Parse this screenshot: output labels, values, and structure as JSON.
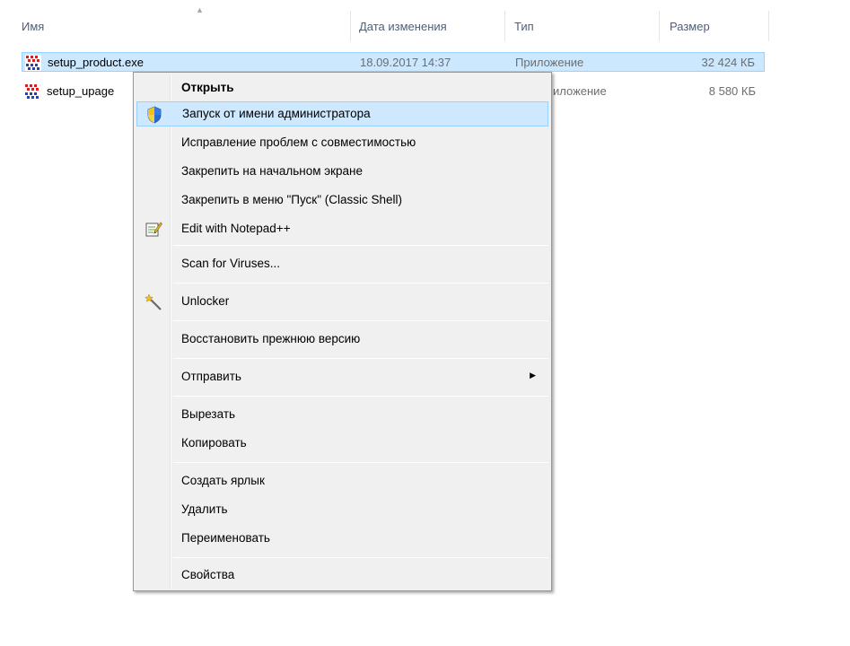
{
  "columns": {
    "name": "Имя",
    "date": "Дата изменения",
    "type": "Тип",
    "size": "Размер"
  },
  "files": [
    {
      "name": "setup_product.exe",
      "date": "18.09.2017 14:37",
      "type": "Приложение",
      "size": "32 424 КБ",
      "icon": "exe-installer-icon",
      "selected": true
    },
    {
      "name": "setup_upage",
      "date": "",
      "type": "иложение",
      "size": "8 580 КБ",
      "icon": "exe-installer-icon",
      "selected": false
    }
  ],
  "context_menu": {
    "open": "Открыть",
    "run_as_admin": "Запуск от имени администратора",
    "troubleshoot_compat": "Исправление проблем с совместимостью",
    "pin_start": "Закрепить на начальном экране",
    "pin_classic_shell": "Закрепить в меню \"Пуск\" (Classic Shell)",
    "edit_notepadpp": "Edit with Notepad++",
    "scan_viruses": "Scan for Viruses...",
    "unlocker": "Unlocker",
    "restore_prev": "Восстановить прежнюю версию",
    "send_to": "Отправить",
    "cut": "Вырезать",
    "copy": "Копировать",
    "create_shortcut": "Создать ярлык",
    "delete": "Удалить",
    "rename": "Переименовать",
    "properties": "Свойства"
  },
  "colors": {
    "selection": "#cce8ff",
    "selection_border": "#99d1ff",
    "menu_bg": "#f0f0f0",
    "header_text": "#4c607a"
  }
}
